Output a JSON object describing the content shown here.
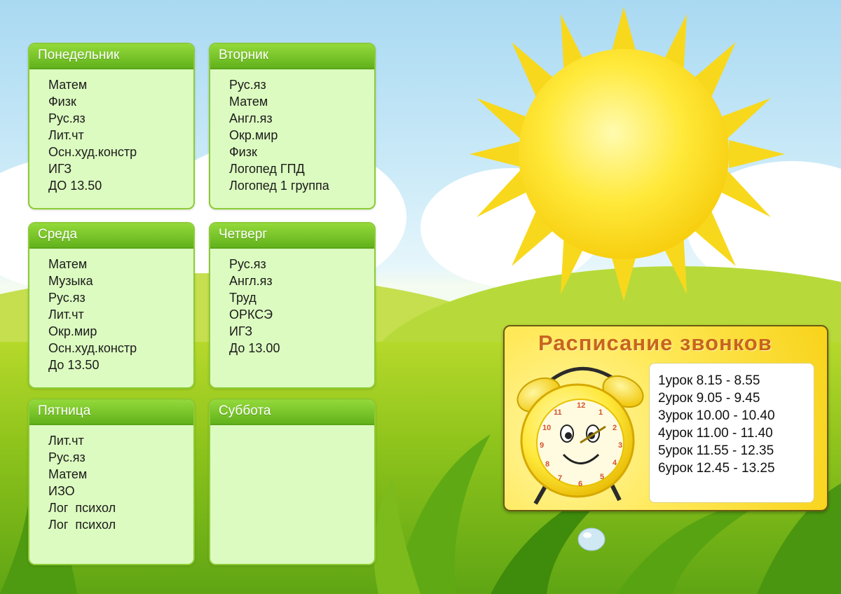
{
  "days": [
    {
      "name": "Понедельник",
      "lessons": [
        "Матем",
        "Физк",
        "Рус.яз",
        "Лит.чт",
        "Осн.худ.констр",
        "ИГЗ",
        "ДО 13.50"
      ]
    },
    {
      "name": "Вторник",
      "lessons": [
        "Рус.яз",
        "Матем",
        "Англ.яз",
        "Окр.мир",
        "Физк",
        "Логопед ГПД",
        "Логопед 1 группа"
      ]
    },
    {
      "name": "Среда",
      "lessons": [
        "Матем",
        "Музыка",
        "Рус.яз",
        "Лит.чт",
        "Окр.мир",
        "Осн.худ.констр",
        "До 13.50"
      ]
    },
    {
      "name": "Четверг",
      "lessons": [
        "Рус.яз",
        "Англ.яз",
        "Труд",
        "ОРКСЭ",
        "ИГЗ",
        "До 13.00"
      ]
    },
    {
      "name": "Пятница",
      "lessons": [
        "Лит.чт",
        "Рус.яз",
        "Матем",
        "ИЗО",
        "Лог  психол",
        "Лог  психол"
      ]
    },
    {
      "name": "Суббота",
      "lessons": []
    }
  ],
  "bells": {
    "title": "Расписание звонков",
    "items": [
      "1урок 8.15 - 8.55",
      "2урок 9.05 - 9.45",
      "3урок 10.00 - 10.40",
      "4урок 11.00 - 11.40",
      "5урок 11.55 - 12.35",
      "6урок 12.45 - 13.25"
    ]
  },
  "colors": {
    "card_bg": "#dcfbc0",
    "card_header": "#62b21c",
    "panel": "#ffe95a",
    "title": "#c8651b"
  },
  "icons": {
    "clock": "alarm-clock-icon",
    "sun": "sun-icon"
  }
}
